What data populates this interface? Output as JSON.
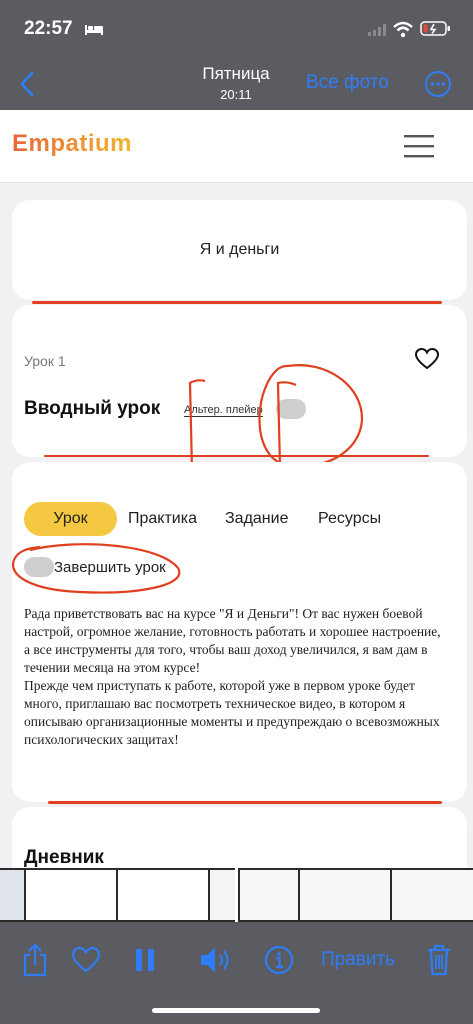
{
  "status_bar": {
    "time": "22:57"
  },
  "nav": {
    "title": "Пятница",
    "subtitle": "20:11",
    "all_photos": "Все фото"
  },
  "site": {
    "logo": "Empatium"
  },
  "course": {
    "title": "Я и деньги"
  },
  "lesson": {
    "number": "Урок 1",
    "title": "Вводный урок",
    "alt_player": "Альтер. плейер"
  },
  "tabs": [
    "Урок",
    "Практика",
    "Задание",
    "Ресурсы"
  ],
  "complete_label": "Завершить урок",
  "body_text": [
    "Рада приветствовать вас на курсе \"Я и Деньги\"! От вас нужен боевой настрой, огромное желание, готовность работать и хорошее настроение, а все инструменты для того, чтобы ваш доход увеличился, я вам дам в течении месяца на этом курсе!",
    "Прежде чем приступать к работе, которой уже в первом уроке будет много, приглашаю вас посмотреть техническое видео, в котором я описываю организационные моменты и предупреждаю о всевозможных психологических защитах!"
  ],
  "diary": {
    "title": "Дневник"
  },
  "toolbar": {
    "edit": "Править"
  },
  "colors": {
    "accent_blue": "#2f7df6",
    "tab_active": "#f5c842",
    "annotation_red": "#e0401f"
  },
  "icons": [
    "bed-icon",
    "wifi-icon",
    "battery-icon",
    "back-chevron-icon",
    "more-icon",
    "hamburger-menu-icon",
    "heart-icon",
    "share-icon",
    "pause-icon",
    "speaker-icon",
    "info-icon",
    "trash-icon"
  ]
}
